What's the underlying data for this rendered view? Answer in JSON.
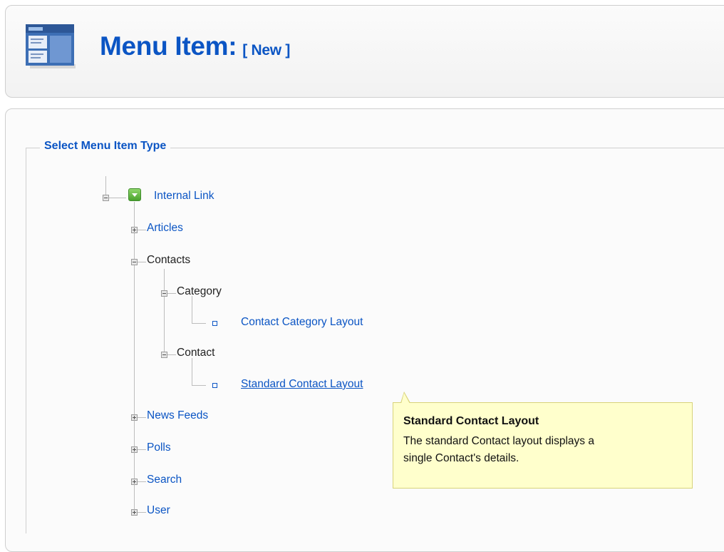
{
  "header": {
    "title": "Menu Item:",
    "title_suffix": "[ New ]",
    "icon": "menu-item-icon"
  },
  "section": {
    "legend": "Select Menu Item Type"
  },
  "tree": {
    "root": {
      "label": "Internal Link",
      "icon": "green-expand-icon"
    },
    "articles": "Articles",
    "contacts": "Contacts",
    "category": "Category",
    "contact_category_layout": "Contact Category Layout",
    "contact": "Contact",
    "standard_contact_layout": "Standard Contact Layout",
    "news_feeds": "News Feeds",
    "polls": "Polls",
    "search": "Search",
    "user": "User"
  },
  "tooltip": {
    "title": "Standard Contact Layout",
    "line1": "The standard Contact layout displays a",
    "line2": "single Contact's details."
  },
  "colors": {
    "link": "#0b55c4",
    "tooltip_bg": "#ffffcc"
  }
}
